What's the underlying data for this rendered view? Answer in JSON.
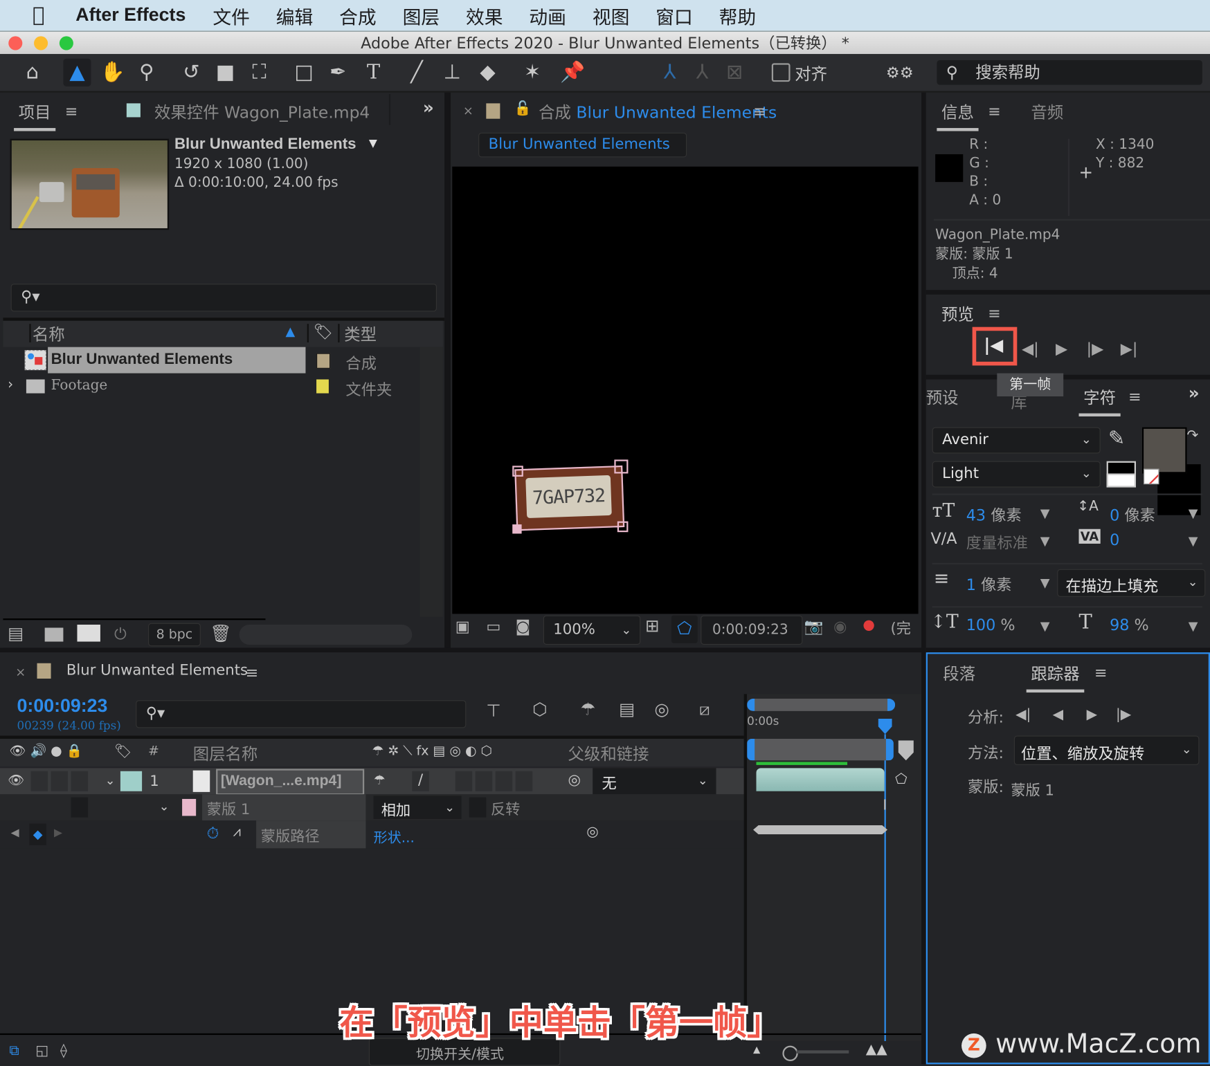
{
  "menubar": {
    "app_name": "After Effects",
    "items": [
      "文件",
      "编辑",
      "合成",
      "图层",
      "效果",
      "动画",
      "视图",
      "窗口",
      "帮助"
    ]
  },
  "window": {
    "title": "Adobe After Effects 2020 - Blur Unwanted Elements（已转换） *"
  },
  "toolbar": {
    "align_label": "对齐",
    "search_placeholder": "搜索帮助"
  },
  "project_panel": {
    "tab_project": "项目",
    "tab_effects": "效果控件 Wagon_Plate.mp4",
    "item_name": "Blur Unwanted Elements",
    "item_dims": "1920 x 1080 (1.00)",
    "item_duration": "Δ 0:00:10:00, 24.00 fps",
    "search_placeholder": "",
    "col_name": "名称",
    "col_type": "类型",
    "rows": [
      {
        "name": "Blur Unwanted Elements",
        "type": "合成",
        "label_color": "#b5a584",
        "selected": true
      },
      {
        "name": "Footage",
        "type": "文件夹",
        "label_color": "#e3d84e",
        "selected": false
      }
    ],
    "bpc": "8 bpc"
  },
  "composition_panel": {
    "tab_prefix": "合成",
    "tab_name": "Blur Unwanted Elements",
    "breadcrumb": "Blur Unwanted Elements",
    "plate_text": "7GAP732",
    "zoom": "100%",
    "timecode": "0:00:09:23",
    "resolution_partial": "(完"
  },
  "info_panel": {
    "tab_info": "信息",
    "tab_audio": "音频",
    "r_label": "R :",
    "g_label": "G :",
    "b_label": "B :",
    "a_label": "A :",
    "a_value": "0",
    "x_label": "X :",
    "x_value": "1340",
    "y_label": "Y :",
    "y_value": "882",
    "file": "Wagon_Plate.mp4",
    "mask": "蒙版: 蒙版 1",
    "vertices": "顶点: 4"
  },
  "preview_panel": {
    "title": "预览",
    "tooltip": "第一帧",
    "highlight_color": "#f0574a"
  },
  "character_panel": {
    "tab_presets": "预设",
    "tab_library": "库",
    "tab_character": "字符",
    "font_family": "Avenir",
    "font_style": "Light",
    "font_size": "43",
    "font_size_unit": "像素",
    "leading": "0",
    "leading_unit": "像素",
    "kerning": "度量标准",
    "tracking": "0",
    "stroke_width": "1",
    "stroke_unit": "像素",
    "stroke_mode": "在描边上填充",
    "vertical_scale": "100",
    "horizontal_scale": "98",
    "percent": "%"
  },
  "tracker_panel": {
    "tab_paragraph": "段落",
    "tab_tracker": "跟踪器",
    "analyze_label": "分析:",
    "method_label": "方法:",
    "method_value": "位置、缩放及旋转",
    "mask_label": "蒙版:",
    "mask_value": "蒙版 1"
  },
  "timeline": {
    "tab_name": "Blur Unwanted Elements",
    "timecode": "0:00:09:23",
    "frame_info": "00239 (24.00 fps)",
    "col_number": "#",
    "col_layer_name": "图层名称",
    "col_parent": "父级和链接",
    "ruler_start": "0:00s",
    "layer": {
      "number": "1",
      "name": "[Wagon_...e.mp4]",
      "label_color": "#9fcfc9",
      "parent": "无"
    },
    "mask": {
      "name": "蒙版 1",
      "label_color": "#e8b8cb",
      "mode": "相加",
      "invert_label": "反转"
    },
    "mask_path": {
      "name": "蒙版路径",
      "value": "形状..."
    },
    "toggle_label": "切换开关/模式",
    "playhead_fraction": 0.99
  },
  "caption": {
    "text": "在「预览」中单击「第一帧」",
    "color": "#f0574a"
  },
  "watermark": {
    "text": "www.MacZ.com",
    "logo_letter": "Z"
  }
}
